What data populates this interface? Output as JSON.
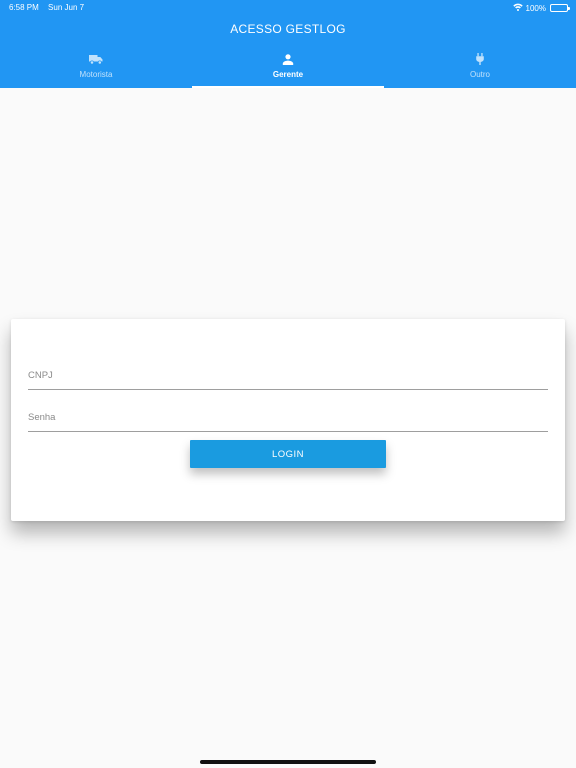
{
  "status_bar": {
    "time": "6:58 PM",
    "date": "Sun Jun 7",
    "battery": "100%",
    "wifi_icon": "wifi-icon",
    "battery_level": 1.0
  },
  "header": {
    "title": "ACESSO GESTLOG",
    "background_color": "#2196f3"
  },
  "tabs": [
    {
      "label": "Motorista",
      "icon": "truck-icon",
      "active": false
    },
    {
      "label": "Gerente",
      "icon": "person-icon",
      "active": true
    },
    {
      "label": "Outro",
      "icon": "plug-icon",
      "active": false
    }
  ],
  "form": {
    "cnpj": {
      "value": "",
      "placeholder": "CNPJ"
    },
    "senha": {
      "value": "",
      "placeholder": "Senha"
    },
    "login_label": "LOGIN",
    "button_color": "#1a9be0"
  }
}
